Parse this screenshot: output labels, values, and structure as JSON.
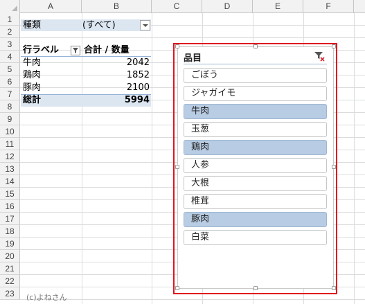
{
  "columns": [
    "A",
    "B",
    "C",
    "D",
    "E",
    "F"
  ],
  "rows": [
    "1",
    "2",
    "3",
    "4",
    "5",
    "6",
    "7",
    "8",
    "9",
    "10",
    "11",
    "12",
    "13",
    "14",
    "15",
    "16",
    "17",
    "18",
    "19",
    "20",
    "21",
    "22",
    "23"
  ],
  "pivot": {
    "filter_label": "種類",
    "filter_value": "(すべて)",
    "row_label_header": "行ラベル",
    "value_header": "合計 / 数量",
    "items": [
      {
        "label": "牛肉",
        "value": "2042"
      },
      {
        "label": "鶏肉",
        "value": "1852"
      },
      {
        "label": "豚肉",
        "value": "2100"
      }
    ],
    "total_label": "総計",
    "total_value": "5994"
  },
  "watermark": "(c)よねさん",
  "slicer": {
    "title": "品目",
    "clear_filter_icon": "filter-clear-icon",
    "items": [
      {
        "label": "ごぼう",
        "selected": false
      },
      {
        "label": "ジャガイモ",
        "selected": false
      },
      {
        "label": "牛肉",
        "selected": true
      },
      {
        "label": "玉葱",
        "selected": false
      },
      {
        "label": "鶏肉",
        "selected": true
      },
      {
        "label": "人参",
        "selected": false
      },
      {
        "label": "大根",
        "selected": false
      },
      {
        "label": "椎茸",
        "selected": false
      },
      {
        "label": "豚肉",
        "selected": true
      },
      {
        "label": "白菜",
        "selected": false
      }
    ],
    "outline_color": "#e0141e",
    "selected_color": "#b8cce4"
  }
}
